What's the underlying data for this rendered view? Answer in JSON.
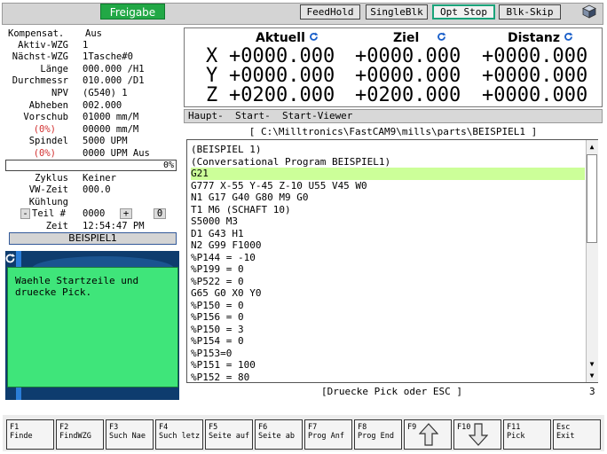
{
  "topbar": {
    "freigabe": "Freigabe",
    "buttons": [
      "FeedHold",
      "SingleBlk",
      "Opt Stop",
      "Blk-Skip"
    ],
    "active_button": "Opt Stop"
  },
  "left": {
    "rows": [
      {
        "label": "Kompensat.",
        "value": "Aus"
      },
      {
        "label": "Aktiv-WZG",
        "value": "1"
      },
      {
        "label": "Nächst-WZG",
        "value": "1Tasche#0"
      },
      {
        "label": "Länge",
        "value": "000.000 /H1"
      },
      {
        "label": "Durchmessr",
        "value": "010.000 /D1"
      },
      {
        "label": "NPV",
        "value": "(G540) 1"
      },
      {
        "label": "Abheben",
        "value": "002.000"
      },
      {
        "label": "Vorschub",
        "value": "01000 mm/M"
      },
      {
        "label": "(0%)",
        "value": "00000 mm/M",
        "red": true
      },
      {
        "label": "Spindel",
        "value": "5000 UPM"
      },
      {
        "label": "(0%)",
        "value": "0000 UPM Aus",
        "red": true
      }
    ],
    "progress": "0%",
    "rows2": [
      {
        "label": "Zyklus",
        "value": "Keiner"
      },
      {
        "label": "VW-Zeit",
        "value": "000.0"
      },
      {
        "label": "Kühlung",
        "value": ""
      }
    ],
    "teil": {
      "minus": "-",
      "label": "Teil #",
      "value": "0000",
      "plus": "+",
      "count": "0"
    },
    "zeit": {
      "label": "Zeit",
      "value": "12:54:47 PM"
    },
    "program_name": "BEISPIEL1",
    "message": "Waehle Startzeile und\ndruecke Pick."
  },
  "coords": {
    "headers": [
      "Aktuell",
      "Ziel",
      "Distanz"
    ],
    "axes": [
      {
        "axis": "X",
        "aktuell": "+0000.000",
        "ziel": "+0000.000",
        "distanz": "+0000.000"
      },
      {
        "axis": "Y",
        "aktuell": "+0000.000",
        "ziel": "+0000.000",
        "distanz": "+0000.000"
      },
      {
        "axis": "Z",
        "aktuell": "+0200.000",
        "ziel": "+0200.000",
        "distanz": "+0000.000"
      }
    ]
  },
  "tabs": "Haupt-  Start-  Start-Viewer",
  "path": "[ C:\\Milltronics\\FastCAM9\\mills\\parts\\BEISPIEL1 ]",
  "program": {
    "lines": [
      "(BEISPIEL 1)",
      "(Conversational Program BEISPIEL1)",
      "G21",
      "G777 X-55 Y-45 Z-10 U55 V45 W0",
      "N1 G17 G40 G80 M9 G0",
      "T1 M6 (SCHAFT 10)",
      "S5000 M3",
      "D1 G43 H1",
      "N2 G99 F1000",
      "%P144 = -10",
      "%P199 = 0",
      "%P522 = 0",
      "G65 G0 X0 Y0",
      "%P150 = 0",
      "%P156 = 0",
      "%P150 = 3",
      "%P154 = 0",
      "%P153=0",
      "%P151 = 100",
      "%P152 = 80"
    ],
    "highlight_index": 2
  },
  "status": {
    "prompt": "[Druecke Pick oder ESC ]",
    "line_no": "3"
  },
  "fkeys": [
    {
      "key": "F1",
      "label": "Finde"
    },
    {
      "key": "F2",
      "label": "FindWZG"
    },
    {
      "key": "F3",
      "label": "Such Nae"
    },
    {
      "key": "F4",
      "label": "Such letz"
    },
    {
      "key": "F5",
      "label": "Seite auf"
    },
    {
      "key": "F6",
      "label": "Seite ab"
    },
    {
      "key": "F7",
      "label": "Prog Anf"
    },
    {
      "key": "F8",
      "label": "Prog End"
    },
    {
      "key": "F9",
      "label": ""
    },
    {
      "key": "F10",
      "label": ""
    },
    {
      "key": "F11",
      "label": "Pick"
    },
    {
      "key": "Esc",
      "label": "Exit"
    }
  ],
  "colors": {
    "accent_green": "#22a846",
    "message_bg": "#3fe57a",
    "highlight": "#ccff99",
    "viewport": "#0e3c6e"
  }
}
